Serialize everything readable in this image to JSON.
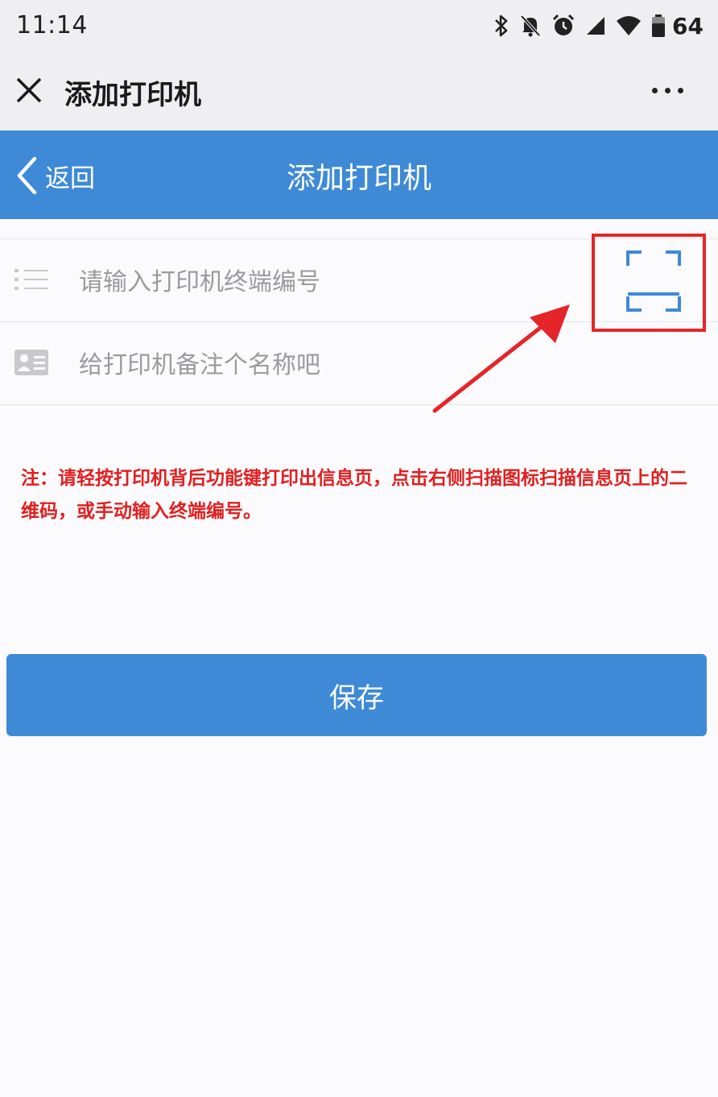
{
  "status_bar": {
    "time": "11:14",
    "battery_level": "64",
    "icons": [
      "bluetooth-icon",
      "bell-off-icon",
      "alarm-icon",
      "signal-icon",
      "wifi-icon",
      "battery-icon"
    ]
  },
  "web_bar": {
    "title": "添加打印机",
    "close_icon": "close-icon",
    "more_icon": "more-icon"
  },
  "app_header": {
    "back_label": "返回",
    "title": "添加打印机"
  },
  "form": {
    "terminal_placeholder": "请输入打印机终端编号",
    "terminal_value": "",
    "name_placeholder": "给打印机备注个名称吧",
    "name_value": "",
    "scan_icon": "scan-icon"
  },
  "note": {
    "text": "注：请轻按打印机背后功能键打印出信息页，点击右侧扫描图标扫描信息页上的二维码，或手动输入终端编号。"
  },
  "save_label": "保存",
  "colors": {
    "brand_blue": "#3e8ad6",
    "note_red": "#e11f1f",
    "highlight_red": "#e5252a"
  }
}
